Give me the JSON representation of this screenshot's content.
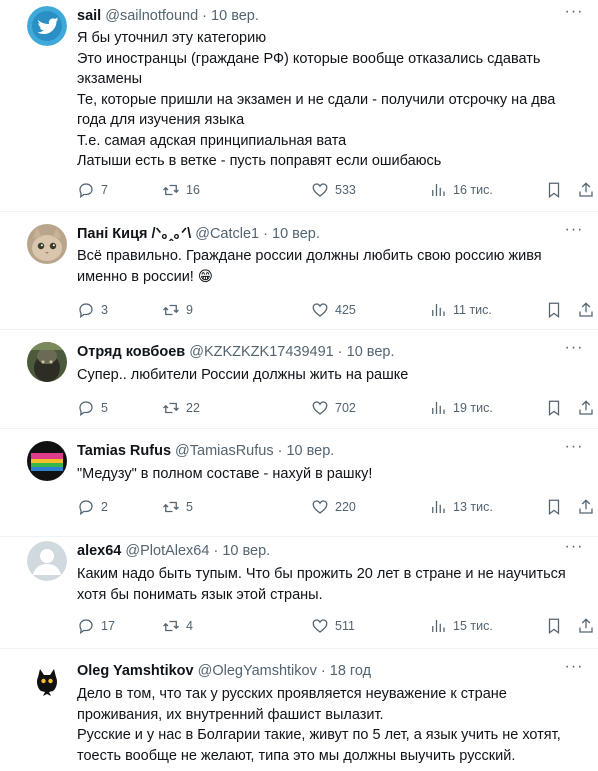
{
  "tweets": [
    {
      "name": "sail",
      "handle": "@sailnotfound",
      "time": "10 вер.",
      "lines": [
        "Я бы уточнил эту категорию",
        "Это иностранцы (граждане РФ) которые вообще отказались сдавать",
        "экзамены",
        "Те, которые пришли на экзамен и не сдали - получили отсрочку на два",
        "года для изучения языка",
        "Т.е. самая адская принципиальная вата",
        "Латыши есть в ветке - пусть поправят если ошибаюсь"
      ],
      "replies": "7",
      "retweets": "16",
      "likes": "533",
      "views": "16 тис."
    },
    {
      "name": "Пані Киця /ᐠ｡ꞈ｡ᐟ\\",
      "handle": "@Catcle1",
      "time": "10 вер.",
      "lines": [
        "Всё правильно. Граждане россии должны любить свою россию живя",
        "именно в россии! 😁"
      ],
      "replies": "3",
      "retweets": "9",
      "likes": "425",
      "views": "11 тис."
    },
    {
      "name": "Отряд ковбоев",
      "handle": "@KZKZKZK17439491",
      "time": "10 вер.",
      "lines": [
        "Супер.. любители России должны жить на рашке"
      ],
      "replies": "5",
      "retweets": "22",
      "likes": "702",
      "views": "19 тис."
    },
    {
      "name": "Tamias Rufus",
      "handle": "@TamiasRufus",
      "time": "10 вер.",
      "lines": [
        "\"Медузу\" в полном составе - нахуй в рашку!"
      ],
      "replies": "2",
      "retweets": "5",
      "likes": "220",
      "views": "13 тис."
    },
    {
      "name": "alex64",
      "handle": "@PlotAlex64",
      "time": "10 вер.",
      "lines": [
        "Каким надо быть тупым. Что бы прожить 20 лет в стране и не научиться",
        "хотя бы понимать язык этой страны."
      ],
      "replies": "17",
      "retweets": "4",
      "likes": "511",
      "views": "15 тис."
    },
    {
      "name": "Oleg Yamshtikov",
      "handle": "@OlegYamshtikov",
      "time": "18 год",
      "lines": [
        "Дело в том, что так у русских проявляется неуважение к стране",
        "проживания, их внутренний фашист вылазит.",
        "Русские и у нас в Болгарии такие, живут по 5 лет, а язык учить не хотят,",
        "тоесть вообще не желают, типа это мы должны выучить русский."
      ]
    }
  ],
  "separator": "·",
  "more_glyph": "···",
  "icons": {
    "reply": "reply-icon",
    "retweet": "retweet-icon",
    "like": "like-icon",
    "views": "views-icon",
    "bookmark": "bookmark-icon",
    "share": "share-icon"
  },
  "colors": {
    "muted": "#536471",
    "text": "#0f1419",
    "divider": "#eff3f4",
    "twitter_blue": "#1d9bf0"
  }
}
